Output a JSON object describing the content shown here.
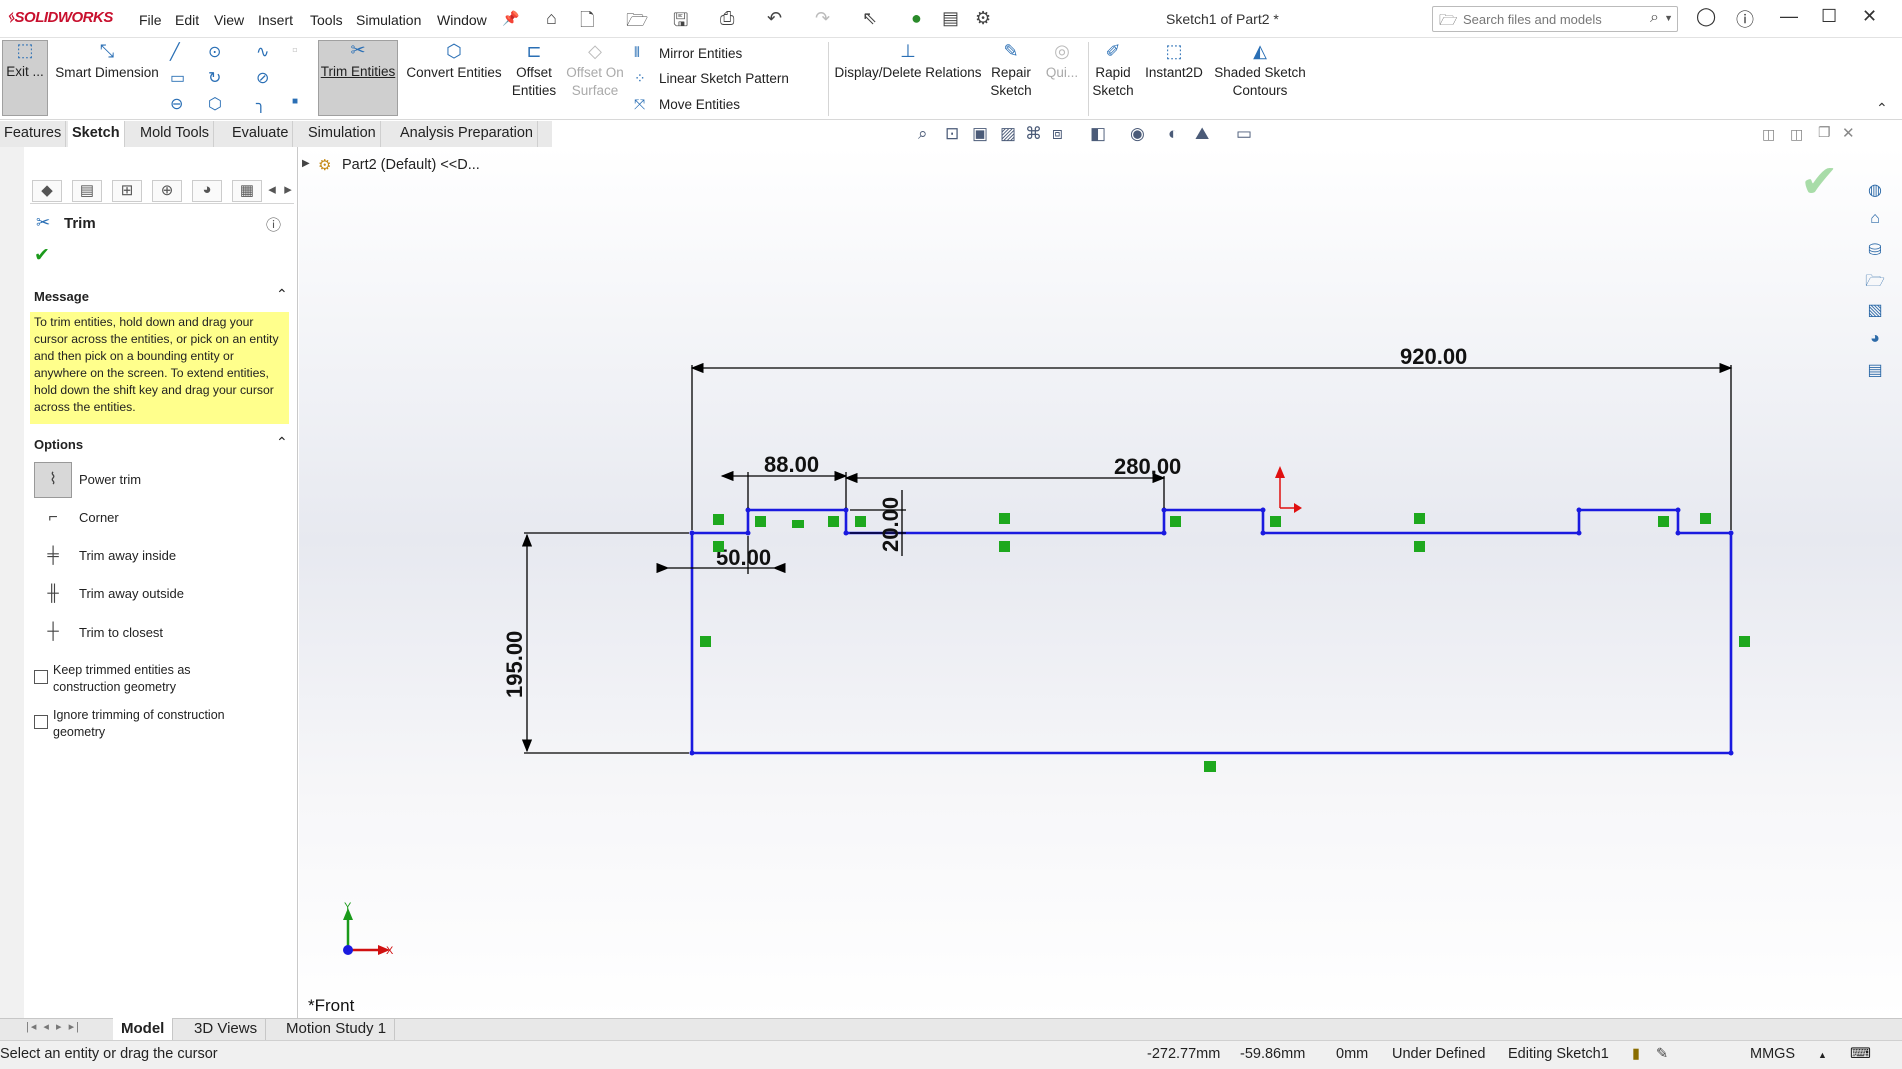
{
  "app": {
    "logo": "SOLIDWORKS",
    "doc_title": "Sketch1 of Part2 *"
  },
  "menu": [
    "File",
    "Edit",
    "View",
    "Insert",
    "Tools",
    "Simulation",
    "Window"
  ],
  "search": {
    "placeholder": "Search files and models"
  },
  "toolbar": {
    "exit": "Exit ...",
    "smart_dimension": "Smart Dimension",
    "trim_entities": "Trim Entities",
    "convert_entities": "Convert Entities",
    "offset_entities_1": "Offset",
    "offset_entities_2": "Entities",
    "offset_surface_1": "Offset On",
    "offset_surface_2": "Surface",
    "mirror_entities": "Mirror Entities",
    "linear_pattern": "Linear Sketch Pattern",
    "move_entities": "Move Entities",
    "display_relations": "Display/Delete Relations",
    "repair_1": "Repair",
    "repair_2": "Sketch",
    "quick": "Qui...",
    "rapid_1": "Rapid",
    "rapid_2": "Sketch",
    "instant2d": "Instant2D",
    "shaded_1": "Shaded Sketch",
    "shaded_2": "Contours"
  },
  "tabs": [
    "Features",
    "Sketch",
    "Mold Tools",
    "Evaluate",
    "Simulation",
    "Analysis Preparation"
  ],
  "property_manager": {
    "title": "Trim",
    "message_header": "Message",
    "message": "To trim entities, hold down and drag your cursor across the entities, or pick on an entity and then pick on a bounding entity or anywhere on the screen.  To extend entities, hold down the shift key and drag your cursor across the entities.",
    "options_header": "Options",
    "options": [
      "Power trim",
      "Corner",
      "Trim away inside",
      "Trim away outside",
      "Trim to closest"
    ],
    "checkbox_1_a": "Keep trimmed entities as",
    "checkbox_1_b": "construction geometry",
    "checkbox_2_a": "Ignore trimming of construction",
    "checkbox_2_b": "geometry"
  },
  "tree": {
    "root": "Part2 (Default) <<D..."
  },
  "sketch": {
    "dims": {
      "overall": "920.00",
      "left_step": "88.00",
      "mid": "280.00",
      "height": "20.00",
      "offset": "50.00",
      "total_height": "195.00"
    },
    "view_label": "*Front",
    "axis_x": "X",
    "axis_y": "Y"
  },
  "bottom_tabs": [
    "Model",
    "3D Views",
    "Motion Study 1"
  ],
  "status": {
    "hint": "Select an entity or drag the cursor",
    "x": "-272.77mm",
    "y": "-59.86mm",
    "z": "0mm",
    "state": "Under Defined",
    "editing": "Editing Sketch1",
    "units": "MMGS"
  },
  "colors": {
    "sketch": "#1a1adf",
    "relation": "#1ea81e",
    "message_bg": "#ffff8c"
  }
}
